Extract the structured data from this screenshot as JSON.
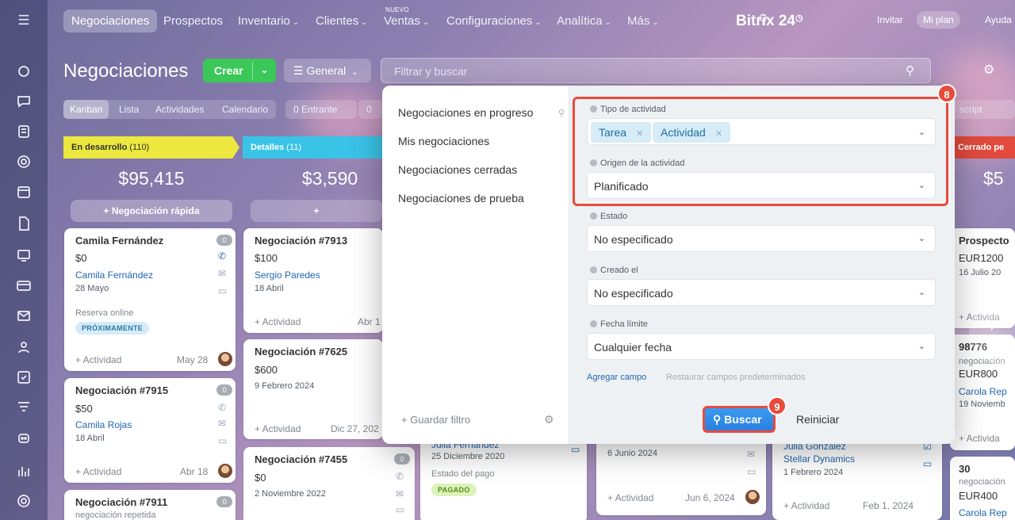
{
  "nav": {
    "items": [
      "Negociaciones",
      "Prospectos",
      "Inventario",
      "Clientes",
      "Ventas",
      "Configuraciones",
      "Analítica",
      "Más"
    ],
    "new_label": "NUEVO",
    "brand": "Bitrix 24",
    "invite": "Invitar",
    "plan": "Mi plan",
    "help": "Ayuda"
  },
  "toolbar": {
    "title": "Negociaciones",
    "create": "Crear",
    "general": "General",
    "search_placeholder": "Filtrar y buscar"
  },
  "views": [
    "Kanban",
    "Lista",
    "Actividades",
    "Calendario"
  ],
  "counters": [
    {
      "value": "0",
      "label": "Entrante"
    },
    {
      "value": "0",
      "label": ""
    }
  ],
  "script_label": "script",
  "columns": [
    {
      "title": "En desarrollo",
      "count": "(110)",
      "sum": "$95,415",
      "quick": "Negociación rápida",
      "color": "#ece83f"
    },
    {
      "title": "Detalles",
      "count": "(11)",
      "sum": "$3,590",
      "color": "#39c3e6"
    },
    {
      "title": "Cerrado pe",
      "sum": "$5",
      "color": "#e14a3c"
    }
  ],
  "cards_col1": [
    {
      "title": "Camila Fernández",
      "amount": "$0",
      "contact": "Camila Fernández",
      "date": "28 Mayo",
      "note": "Reserva online",
      "tag": "PRÓXIMAMENTE",
      "activity": "+ Actividad",
      "due": "May 28",
      "badge": "0"
    },
    {
      "title": "Negociación #7915",
      "amount": "$50",
      "contact": "Camila Rojas",
      "date": "18 Abril",
      "activity": "+ Actividad",
      "due": "Abr 18",
      "badge": "0"
    },
    {
      "title": "Negociación #7911",
      "note": "negociación repetida",
      "badge": "0"
    }
  ],
  "cards_col2": [
    {
      "title": "Negociación #7913",
      "amount": "$100",
      "contact": "Sergio Paredes",
      "date": "18 Abril",
      "activity": "+ Actividad",
      "due": "Abr 1"
    },
    {
      "title": "Negociación #7625",
      "amount": "$600",
      "date": "9 Febrero 2024",
      "activity": "+ Actividad",
      "due": "Dic 27, 202"
    },
    {
      "title": "Negociación #7455",
      "amount": "$0",
      "date": "2 Noviembre 2022",
      "badge": "0"
    }
  ],
  "cards_col3": [
    {
      "contact": "Julia Fernández",
      "date": "25 Diciembre 2020",
      "note": "Estado del pago",
      "tag": "PAGADO"
    }
  ],
  "cards_col4": [
    {
      "date": "6 Junio 2024",
      "activity": "+ Actividad",
      "due": "Jun 6, 2024"
    }
  ],
  "cards_col5": [
    {
      "contact": "Julia González",
      "company": "Stellar Dynamics",
      "date": "1 Febrero 2024",
      "activity": "+ Actividad",
      "due": "Feb 1, 2024"
    }
  ],
  "cards_col6": [
    {
      "title": "Prospecto",
      "amount": "EUR1200",
      "date": "16 Julio 20",
      "activity": "+ Activida"
    },
    {
      "title": "98776",
      "note": "negociación",
      "amount": "EUR800",
      "contact": "Carola Rep",
      "date": "19 Noviemb",
      "activity": "+ Activida"
    },
    {
      "title": "30",
      "note": "negociación",
      "amount": "EUR400",
      "contact": "Carola Rep"
    }
  ],
  "dialog": {
    "presets": [
      "Negociaciones en progreso",
      "Mis negociaciones",
      "Negociaciones cerradas",
      "Negociaciones de prueba"
    ],
    "save_filter": "+ Guardar filtro",
    "fields": [
      {
        "label": "Tipo de actividad",
        "chips": [
          "Tarea",
          "Actividad"
        ]
      },
      {
        "label": "Origen de la actividad",
        "value": "Planificado"
      },
      {
        "label": "Estado",
        "value": "No especificado"
      },
      {
        "label": "Creado el",
        "value": "No especificado"
      },
      {
        "label": "Fecha límite",
        "value": "Cualquier fecha"
      }
    ],
    "add_field": "Agregar campo",
    "restore": "Restaurar campos predeterminados",
    "search": "Buscar",
    "reset": "Reiniciar"
  },
  "callouts": [
    "8",
    "9"
  ],
  "colors": {
    "accent_red": "#e84a3c",
    "create_green": "#3bc859",
    "search_blue": "#2a7fe0",
    "link": "#2067b0"
  }
}
